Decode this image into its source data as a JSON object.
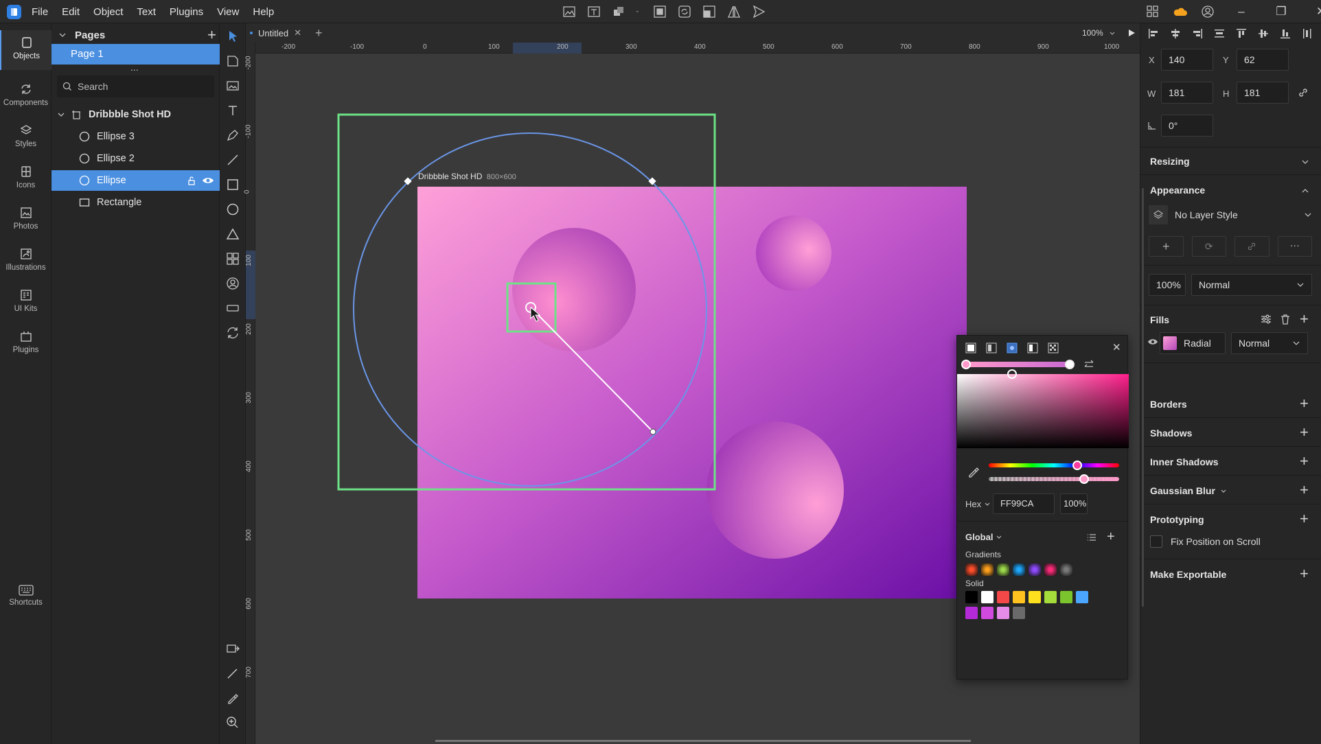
{
  "menu": [
    "File",
    "Edit",
    "Object",
    "Text",
    "Plugins",
    "View",
    "Help"
  ],
  "rail": [
    {
      "id": "objects",
      "label": "Objects",
      "icon": "objects-icon"
    },
    {
      "id": "components",
      "label": "Components",
      "icon": "components-icon"
    },
    {
      "id": "styles",
      "label": "Styles",
      "icon": "styles-icon"
    },
    {
      "id": "icons",
      "label": "Icons",
      "icon": "icons-icon"
    },
    {
      "id": "photos",
      "label": "Photos",
      "icon": "photos-icon"
    },
    {
      "id": "illustrations",
      "label": "Illustrations",
      "icon": "illustrations-icon"
    },
    {
      "id": "uikits",
      "label": "UI Kits",
      "icon": "uikits-icon"
    },
    {
      "id": "plugins",
      "label": "Plugins",
      "icon": "plugins-icon"
    }
  ],
  "shortcuts_label": "Shortcuts",
  "pages": {
    "title": "Pages",
    "items": [
      "Page 1"
    ],
    "more": "..."
  },
  "search": {
    "placeholder": "Search"
  },
  "layers": {
    "artboard": "Dribbble Shot HD",
    "items": [
      {
        "name": "Ellipse 3",
        "type": "ellipse",
        "selected": false
      },
      {
        "name": "Ellipse 2",
        "type": "ellipse",
        "selected": false
      },
      {
        "name": "Ellipse",
        "type": "ellipse",
        "selected": true
      },
      {
        "name": "Rectangle",
        "type": "rectangle",
        "selected": false
      }
    ]
  },
  "tab": {
    "title": "Untitled",
    "zoom": "100%"
  },
  "ruler": {
    "top": [
      "-200",
      "-100",
      "0",
      "100",
      "200",
      "300",
      "400",
      "500",
      "600",
      "700",
      "800",
      "900",
      "1000"
    ],
    "left": [
      "-200",
      "-100",
      "0",
      "100",
      "200",
      "300",
      "400",
      "500",
      "600",
      "700"
    ]
  },
  "artboard": {
    "title": "Dribbble Shot HD",
    "size": "800×600"
  },
  "inspector": {
    "x_label": "X",
    "x": "140",
    "y_label": "Y",
    "y": "62",
    "w_label": "W",
    "w": "181",
    "h_label": "H",
    "h": "181",
    "angle": "0°",
    "resizing": "Resizing",
    "appearance": "Appearance",
    "layer_style": "No Layer Style",
    "opacity": "100%",
    "blend": "Normal",
    "fills": "Fills",
    "fill": {
      "type": "Radial",
      "blend": "Normal"
    },
    "borders": "Borders",
    "shadows": "Shadows",
    "inner_shadows": "Inner Shadows",
    "gaussian_blur": "Gaussian Blur",
    "prototyping": "Prototyping",
    "fix_position": "Fix Position on Scroll",
    "make_exportable": "Make Exportable"
  },
  "picker": {
    "format": "Hex",
    "hex": "FF99CA",
    "alpha": "100%",
    "library": "Global",
    "gradients_label": "Gradients",
    "solid_label": "Solid",
    "gradients": [
      "#ff4e2a",
      "#ffa01e",
      "#9bd84a",
      "#1ea8ff",
      "#8f4bff",
      "#ff2a7a",
      "#7a7a7a"
    ],
    "solids": [
      "#000000",
      "#ffffff",
      "#f44848",
      "#ffc21e",
      "#ffe01e",
      "#a4dc3c",
      "#7cc42e",
      "#4aa6ff",
      "#b42ad8",
      "#d04ae0",
      "#e58ce8",
      "#6a6a6a"
    ]
  },
  "colors": {
    "accent": "#5b9bf0",
    "selection": "#6de286",
    "gradient_start": "#ff99ca",
    "gradient_end": "#6a0fa6"
  }
}
